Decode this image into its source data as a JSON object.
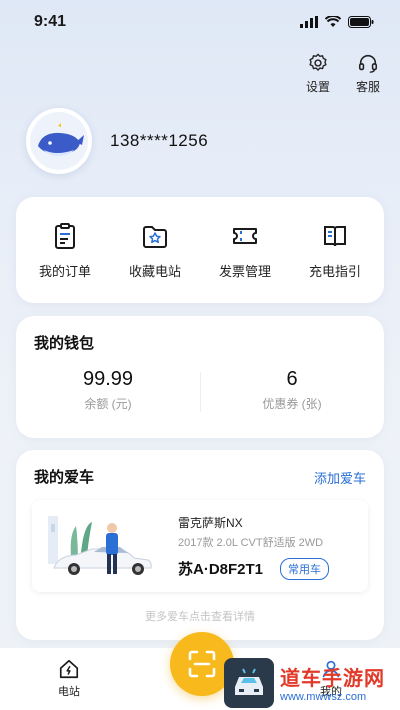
{
  "status": {
    "time": "9:41"
  },
  "top_actions": [
    {
      "label": "设置",
      "icon": "gear-icon"
    },
    {
      "label": "客服",
      "icon": "headset-icon"
    }
  ],
  "profile": {
    "phone": "138****1256"
  },
  "menu": [
    {
      "label": "我的订单",
      "icon": "order-clipboard-icon"
    },
    {
      "label": "收藏电站",
      "icon": "favorite-folder-icon"
    },
    {
      "label": "发票管理",
      "icon": "invoice-ticket-icon"
    },
    {
      "label": "充电指引",
      "icon": "guide-book-icon"
    }
  ],
  "wallet": {
    "title": "我的钱包",
    "balance_value": "99.99",
    "balance_label": "余额 (元)",
    "coupon_value": "6",
    "coupon_label": "优惠券 (张)"
  },
  "cars": {
    "title": "我的爱车",
    "add_label": "添加爱车",
    "item": {
      "name": "雷克萨斯NX",
      "spec": "2017款 2.0L CVT舒适版 2WD",
      "plate": "苏A·D8F2T1",
      "tag": "常用车"
    },
    "more": "更多爱车点击查看详情"
  },
  "tabbar": {
    "station_label": "电站",
    "mine_label": "我的"
  },
  "watermark": {
    "title": "道车手游网",
    "url": "www.mwwsz.com"
  },
  "colors": {
    "accent": "#2a6fd6",
    "scan": "#f7b91b",
    "background": "#e8eef8"
  }
}
